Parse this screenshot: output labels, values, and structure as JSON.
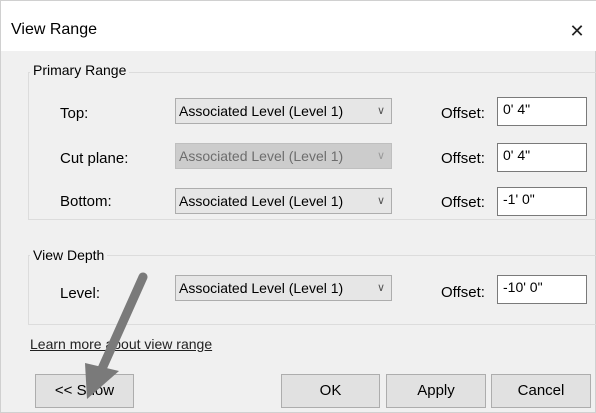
{
  "window": {
    "title": "View Range",
    "close_glyph": "✕"
  },
  "primary_range": {
    "legend": "Primary Range",
    "rows": [
      {
        "label": "Top:",
        "combo": "Associated Level (Level 1)",
        "offset_label": "Offset:",
        "offset_value": "0'  4\""
      },
      {
        "label": "Cut plane:",
        "combo": "Associated Level (Level 1)",
        "offset_label": "Offset:",
        "offset_value": "0'  4\""
      },
      {
        "label": "Bottom:",
        "combo": "Associated Level (Level 1)",
        "offset_label": "Offset:",
        "offset_value": "-1'  0\""
      }
    ]
  },
  "view_depth": {
    "legend": "View Depth",
    "label": "Level:",
    "combo": "Associated Level (Level 1)",
    "offset_label": "Offset:",
    "offset_value": "-10'  0\""
  },
  "chevron_glyph": "∨",
  "link": {
    "text": "Learn more about view range"
  },
  "buttons": {
    "show": "<< Show",
    "ok": "OK",
    "apply": "Apply",
    "cancel": "Cancel"
  },
  "colors": {
    "annotation_arrow": "#7a7a7a",
    "disabled_combo": "#cccccc"
  },
  "icons": {
    "close": "close-icon",
    "dropdown": "chevron-down-icon",
    "annotation": "arrow-annotation-icon"
  }
}
